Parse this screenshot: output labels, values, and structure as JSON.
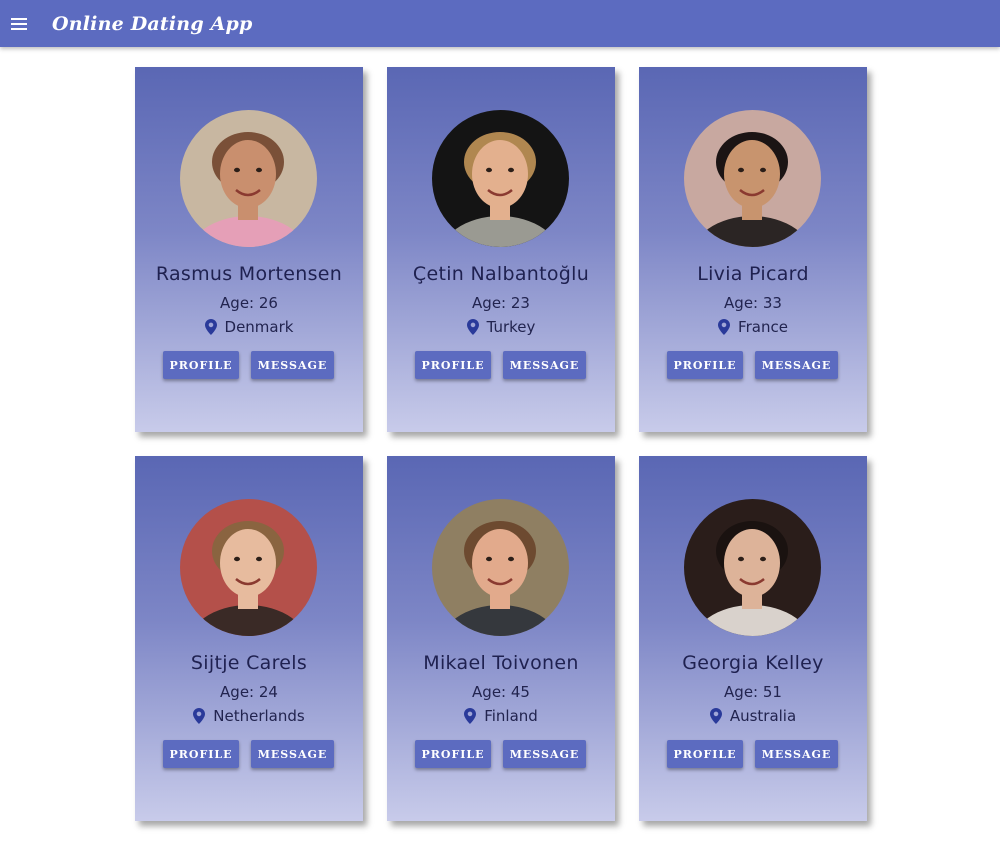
{
  "appbar": {
    "title": "Online Dating App",
    "color": "#5c6bc0",
    "menu_icon": "menu-icon"
  },
  "buttons": {
    "profile_label": "PROFILE",
    "message_label": "MESSAGE"
  },
  "profiles": [
    {
      "name": "Rasmus Mortensen",
      "age": "Age: 26",
      "location": "Denmark",
      "avatar": {
        "bg": "#c8b7a1",
        "skin": "#c98f6e",
        "hair": "#7a5038",
        "shirt": "#e59fb7"
      }
    },
    {
      "name": "Çetin Nalbantoğlu",
      "age": "Age: 23",
      "location": "Turkey",
      "avatar": {
        "bg": "#141414",
        "skin": "#e3b08e",
        "hair": "#b08750",
        "shirt": "#9a9a92"
      }
    },
    {
      "name": "Livia Picard",
      "age": "Age: 33",
      "location": "France",
      "avatar": {
        "bg": "#c8a8a0",
        "skin": "#c8946e",
        "hair": "#1b1414",
        "shirt": "#2b2524"
      }
    },
    {
      "name": "Sijtje Carels",
      "age": "Age: 24",
      "location": "Netherlands",
      "avatar": {
        "bg": "#b4504a",
        "skin": "#e7bb9e",
        "hair": "#8a6440",
        "shirt": "#3a2a26"
      }
    },
    {
      "name": "Mikael Toivonen",
      "age": "Age: 45",
      "location": "Finland",
      "avatar": {
        "bg": "#8f7f62",
        "skin": "#e2aa8c",
        "hair": "#6d4a30",
        "shirt": "#35383d"
      }
    },
    {
      "name": "Georgia Kelley",
      "age": "Age: 51",
      "location": "Australia",
      "avatar": {
        "bg": "#2a1d1a",
        "skin": "#ddb399",
        "hair": "#1a1210",
        "shirt": "#d9d2cc"
      }
    }
  ]
}
